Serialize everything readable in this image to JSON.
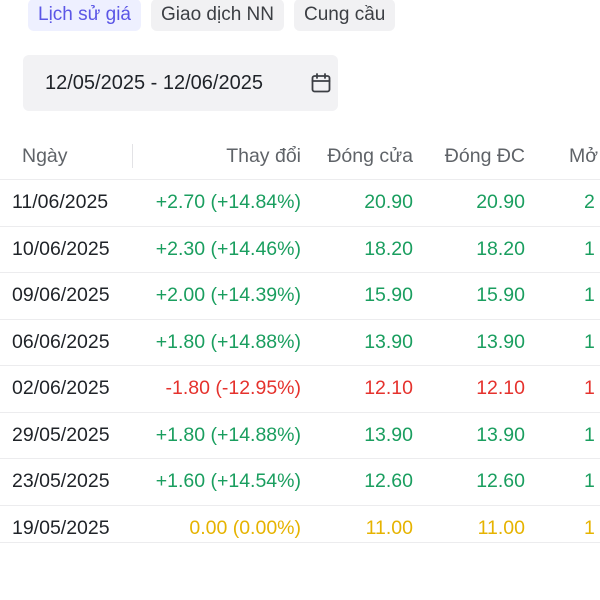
{
  "tabs": [
    {
      "label": "Lịch sử giá",
      "active": true
    },
    {
      "label": "Giao dịch NN",
      "active": false
    },
    {
      "label": "Cung cầu",
      "active": false
    }
  ],
  "date_range": {
    "value": "12/05/2025 - 12/06/2025",
    "icon": "calendar-icon"
  },
  "table": {
    "headers": {
      "date": "Ngày",
      "change": "Thay đổi",
      "close": "Đóng cửa",
      "adj_close": "Đóng ĐC",
      "open": "Mở"
    },
    "rows": [
      {
        "date": "11/06/2025",
        "change": "+2.70 (+14.84%)",
        "close": "20.90",
        "adj_close": "20.90",
        "open": "2",
        "trend": "up"
      },
      {
        "date": "10/06/2025",
        "change": "+2.30 (+14.46%)",
        "close": "18.20",
        "adj_close": "18.20",
        "open": "1",
        "trend": "up"
      },
      {
        "date": "09/06/2025",
        "change": "+2.00 (+14.39%)",
        "close": "15.90",
        "adj_close": "15.90",
        "open": "1",
        "trend": "up"
      },
      {
        "date": "06/06/2025",
        "change": "+1.80 (+14.88%)",
        "close": "13.90",
        "adj_close": "13.90",
        "open": "1",
        "trend": "up"
      },
      {
        "date": "02/06/2025",
        "change": "-1.80 (-12.95%)",
        "close": "12.10",
        "adj_close": "12.10",
        "open": "1",
        "trend": "down"
      },
      {
        "date": "29/05/2025",
        "change": "+1.80 (+14.88%)",
        "close": "13.90",
        "adj_close": "13.90",
        "open": "1",
        "trend": "up"
      },
      {
        "date": "23/05/2025",
        "change": "+1.60 (+14.54%)",
        "close": "12.60",
        "adj_close": "12.60",
        "open": "1",
        "trend": "up"
      },
      {
        "date": "19/05/2025",
        "change": "0.00 (0.00%)",
        "close": "11.00",
        "adj_close": "11.00",
        "open": "1",
        "trend": "flat"
      }
    ]
  },
  "colors": {
    "up": "#1a9e5f",
    "down": "#e5322d",
    "flat": "#e6b300",
    "accent": "#5b56e6"
  }
}
